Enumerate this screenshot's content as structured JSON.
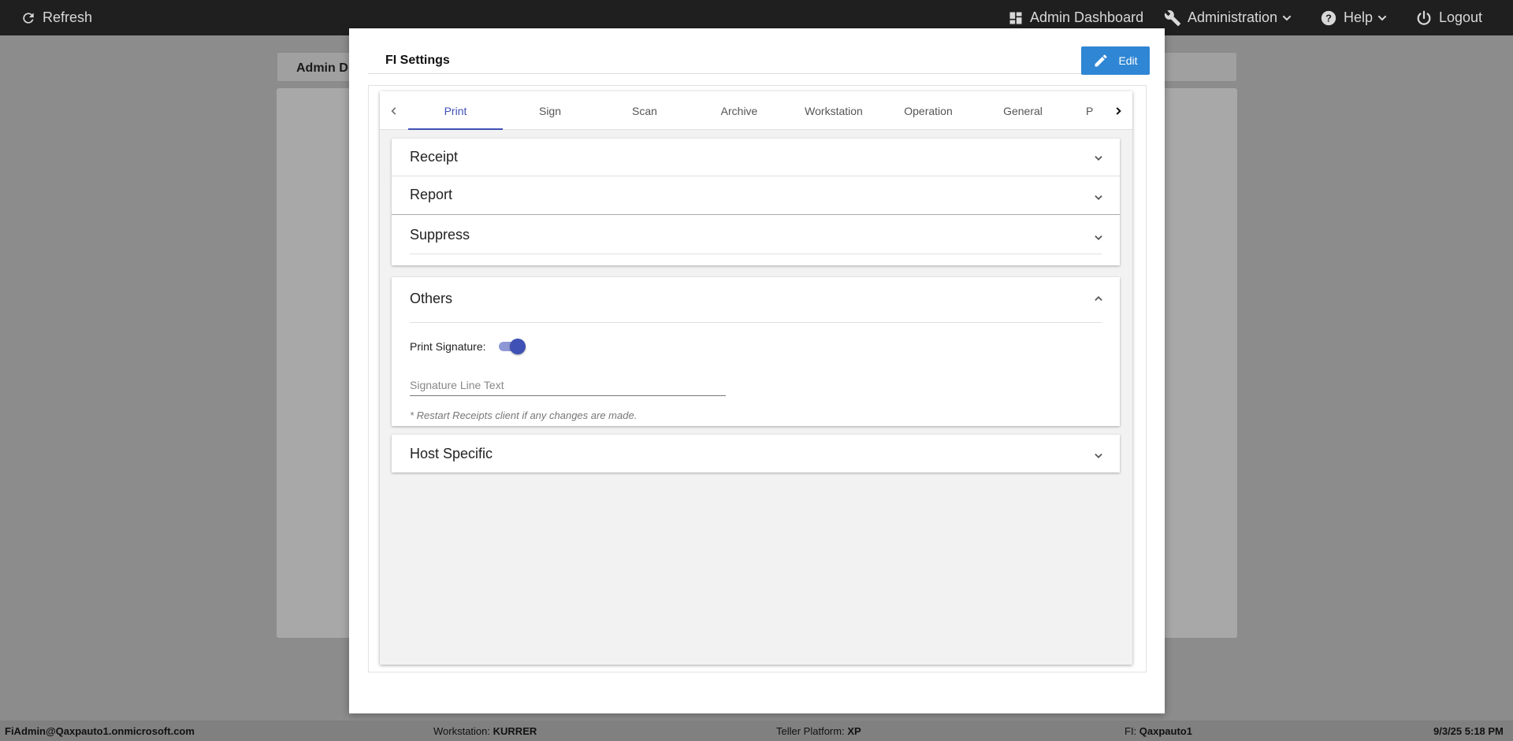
{
  "topbar": {
    "refresh_label": "Refresh",
    "admin_dashboard_label": "Admin Dashboard",
    "administration_label": "Administration",
    "help_label": "Help",
    "logout_label": "Logout"
  },
  "background": {
    "tab_label": "Admin D"
  },
  "modal": {
    "title": "FI Settings",
    "edit_label": "Edit",
    "tabs": [
      {
        "label": "Print",
        "active": true
      },
      {
        "label": "Sign"
      },
      {
        "label": "Scan"
      },
      {
        "label": "Archive"
      },
      {
        "label": "Workstation"
      },
      {
        "label": "Operation"
      },
      {
        "label": "General"
      },
      {
        "label": "P"
      }
    ],
    "panels": {
      "receipt": {
        "title": "Receipt",
        "expanded": false
      },
      "report": {
        "title": "Report",
        "expanded": false
      },
      "suppress": {
        "title": "Suppress",
        "expanded": false
      },
      "others": {
        "title": "Others",
        "expanded": true,
        "print_signature_label": "Print Signature:",
        "print_signature_on": true,
        "signature_line_placeholder": "Signature Line Text",
        "signature_line_value": "",
        "note": "* Restart Receipts client if any changes are made."
      },
      "host_specific": {
        "title": "Host Specific",
        "expanded": false
      }
    }
  },
  "statusbar": {
    "user": "FiAdmin@Qaxpauto1.onmicrosoft.com",
    "workstation_label": "Workstation:",
    "workstation_value": "KURRER",
    "platform_label": "Teller Platform:",
    "platform_value": "XP",
    "fi_label": "FI:",
    "fi_value": "Qaxpauto1",
    "datetime": "9/3/25 5:18 PM"
  },
  "colors": {
    "topbar_bg": "#1f1f1f",
    "accent": "#3f51b5",
    "edit_button": "#2f86d4",
    "overlay": "#8c8c8c"
  }
}
